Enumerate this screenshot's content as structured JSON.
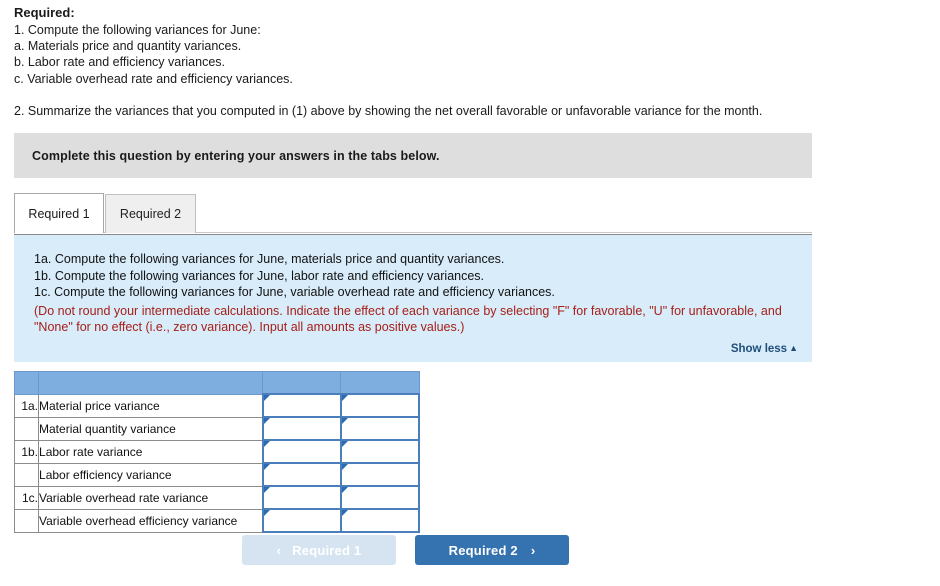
{
  "required": {
    "title": "Required:",
    "lines": [
      "1. Compute the following variances for June:",
      "a. Materials price and quantity variances.",
      "b. Labor rate and efficiency variances.",
      "c. Variable overhead rate and efficiency variances."
    ],
    "summary": "2. Summarize the variances that you computed in (1) above by showing the net overall favorable or unfavorable variance for the month."
  },
  "banner": {
    "text": "Complete this question by entering your answers in the tabs below."
  },
  "tabs": [
    {
      "label": "Required 1",
      "active": true
    },
    {
      "label": "Required 2",
      "active": false
    }
  ],
  "info_panel": {
    "lines": [
      "1a. Compute the following variances for June, materials price and quantity variances.",
      "1b. Compute the following variances for June, labor rate and efficiency variances.",
      "1c. Compute the following variances for June, variable overhead rate and efficiency variances."
    ],
    "note": "(Do not round your intermediate calculations. Indicate the effect of each variance by selecting \"F\" for favorable, \"U\" for unfavorable, and \"None\" for no effect (i.e., zero variance). Input all amounts as positive values.)",
    "note_color": "#a52019",
    "show_less_label": "Show less",
    "show_less_caret": "▲",
    "background": "#d9ecfa"
  },
  "grid": {
    "header_color": "#7eaee0",
    "header": {
      "no": "",
      "desc": "",
      "amount": "",
      "effect": ""
    },
    "rows": [
      {
        "no": "1a.",
        "desc": "Material price variance",
        "amount": "",
        "effect": ""
      },
      {
        "no": "",
        "desc": "Material quantity variance",
        "amount": "",
        "effect": ""
      },
      {
        "no": "1b.",
        "desc": "Labor rate variance",
        "amount": "",
        "effect": ""
      },
      {
        "no": "",
        "desc": "Labor efficiency variance",
        "amount": "",
        "effect": ""
      },
      {
        "no": "1c.",
        "desc": "Variable overhead rate variance",
        "amount": "",
        "effect": ""
      },
      {
        "no": "",
        "desc": "Variable overhead efficiency variance",
        "amount": "",
        "effect": ""
      }
    ]
  },
  "nav": {
    "prev": {
      "label": "Required 1",
      "chevron": "‹",
      "disabled": true,
      "color": "#d6e4f2"
    },
    "next": {
      "label": "Required 2",
      "chevron": "›",
      "disabled": false,
      "color": "#3572b0"
    }
  }
}
